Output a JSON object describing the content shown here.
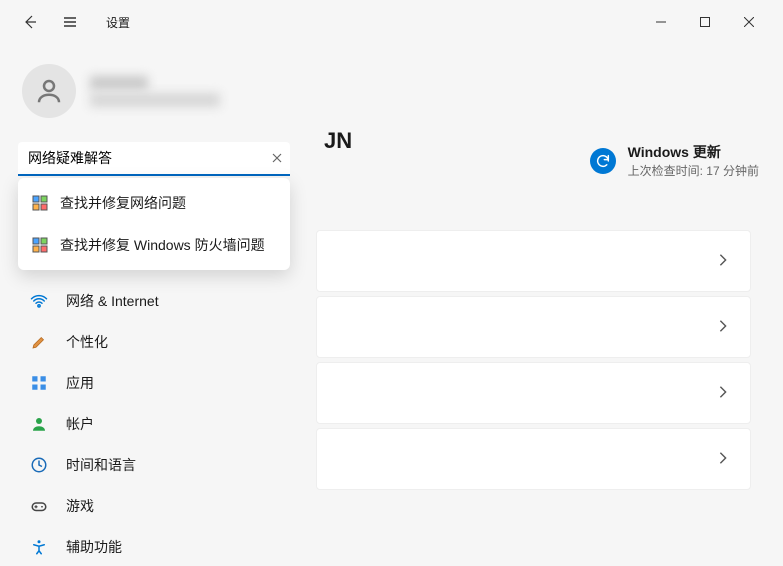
{
  "titlebar": {
    "app_title": "设置"
  },
  "search": {
    "value": "网络疑难解答",
    "results": [
      {
        "label": "查找并修复网络问题"
      },
      {
        "label": "查找并修复 Windows 防火墙问题"
      }
    ]
  },
  "nav": {
    "items": [
      {
        "label": "网络 & Internet",
        "icon": "wifi"
      },
      {
        "label": "个性化",
        "icon": "brush"
      },
      {
        "label": "应用",
        "icon": "apps"
      },
      {
        "label": "帐户",
        "icon": "person"
      },
      {
        "label": "时间和语言",
        "icon": "time"
      },
      {
        "label": "游戏",
        "icon": "game"
      },
      {
        "label": "辅助功能",
        "icon": "accessibility"
      }
    ]
  },
  "main": {
    "heading_fragment": "JN",
    "update": {
      "title": "Windows 更新",
      "subtitle": "上次检查时间: 17 分钟前"
    }
  }
}
